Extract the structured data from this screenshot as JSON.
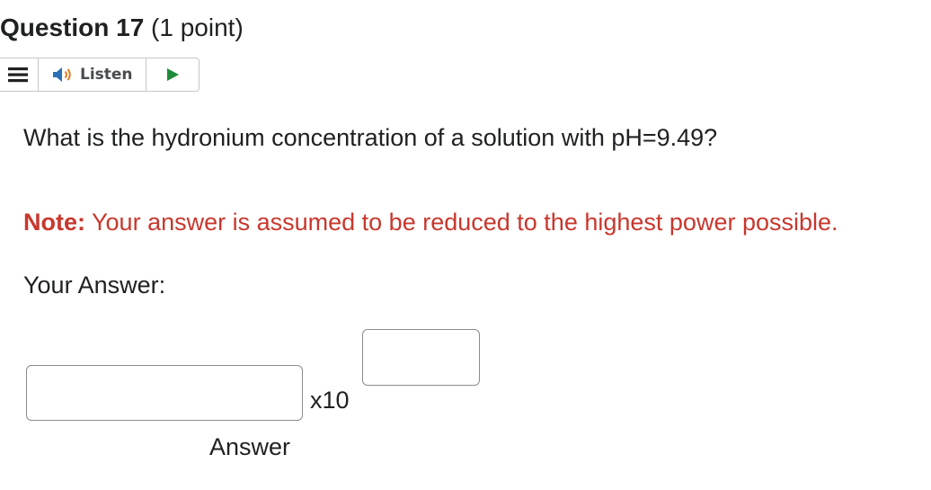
{
  "question": {
    "title": "Question 17",
    "points": " (1 point)"
  },
  "toolbar": {
    "menu_icon": "hamburger-menu-icon",
    "listen_icon": "speaker-icon",
    "listen_label": "Listen",
    "play_icon": "play-icon"
  },
  "body": {
    "prompt": "What is the hydronium concentration of a solution with pH=9.49?",
    "note_label": "Note:",
    "note_text": " Your answer is assumed to be reduced to the highest power possible.",
    "your_answer_label": "Your Answer:"
  },
  "answer": {
    "mantissa_value": "",
    "times_ten_label": "x10",
    "exponent_value": "",
    "answer_caption": "Answer"
  },
  "colors": {
    "note_red": "#c8372d",
    "text": "#202122",
    "border": "#8a8c8f",
    "play_green": "#1e8b3a",
    "speaker_blue": "#2b6fb6"
  }
}
